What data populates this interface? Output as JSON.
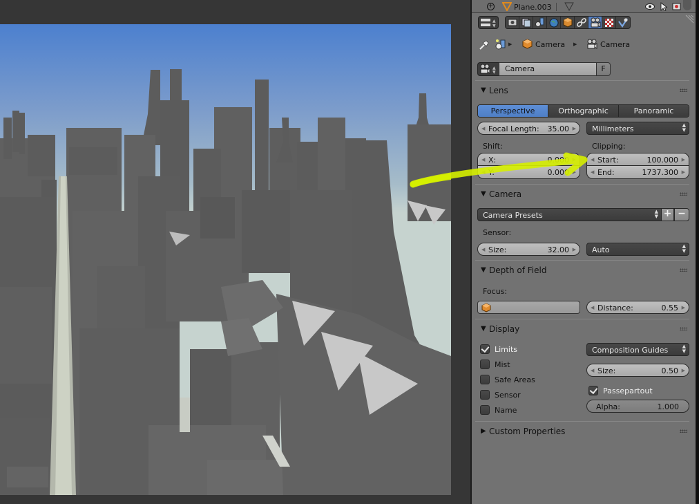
{
  "outliner": {
    "object_name": "Plane.003"
  },
  "properties_tabs": [
    {
      "icon": "render-icon",
      "active": false
    },
    {
      "icon": "render-layers-icon",
      "active": false
    },
    {
      "icon": "scene-icon",
      "active": false
    },
    {
      "icon": "world-icon",
      "active": false
    },
    {
      "icon": "object-icon",
      "active": false
    },
    {
      "icon": "constraints-icon",
      "active": false
    },
    {
      "icon": "camera-data-icon",
      "active": true
    },
    {
      "icon": "texture-icon",
      "active": false
    },
    {
      "icon": "particles-icon",
      "active": false
    }
  ],
  "breadcrumb": {
    "object": "Camera",
    "data": "Camera"
  },
  "datablock": {
    "name": "Camera",
    "fake_user_label": "F"
  },
  "lens": {
    "title": "Lens",
    "projection_options": [
      "Perspective",
      "Orthographic",
      "Panoramic"
    ],
    "projection_selected": "Perspective",
    "focal_length_label": "Focal Length:",
    "focal_length": "35.00",
    "lens_unit": "Millimeters",
    "shift_label": "Shift:",
    "shift_x_label": "X:",
    "shift_x": "0.000",
    "shift_y_label": "Y:",
    "shift_y": "0.000",
    "clipping_label": "Clipping:",
    "clip_start_label": "Start:",
    "clip_start": "100.000",
    "clip_end_label": "End:",
    "clip_end": "1737.300"
  },
  "camera": {
    "title": "Camera",
    "presets_label": "Camera Presets",
    "add_label": "+",
    "remove_label": "−",
    "sensor_label": "Sensor:",
    "size_label": "Size:",
    "size": "32.00",
    "sensor_fit": "Auto"
  },
  "dof": {
    "title": "Depth of Field",
    "focus_label": "Focus:",
    "distance_label": "Distance:",
    "distance": "0.55"
  },
  "display": {
    "title": "Display",
    "checkboxes": [
      {
        "label": "Limits",
        "checked": true
      },
      {
        "label": "Mist",
        "checked": false
      },
      {
        "label": "Safe Areas",
        "checked": false
      },
      {
        "label": "Sensor",
        "checked": false
      },
      {
        "label": "Name",
        "checked": false
      }
    ],
    "guides_dropdown": "Composition Guides",
    "size_label": "Size:",
    "size": "0.50",
    "passepartout_label": "Passepartout",
    "passepartout_checked": true,
    "alpha_label": "Alpha:",
    "alpha": "1.000"
  },
  "custom_properties": {
    "title": "Custom Properties"
  },
  "annotation": {
    "type": "arrow",
    "color": "#d8f000",
    "points_to": "Clipping Start"
  },
  "colors": {
    "panel_bg": "#727272",
    "accent": "#5680c2",
    "viewport_bg": "#363636"
  }
}
